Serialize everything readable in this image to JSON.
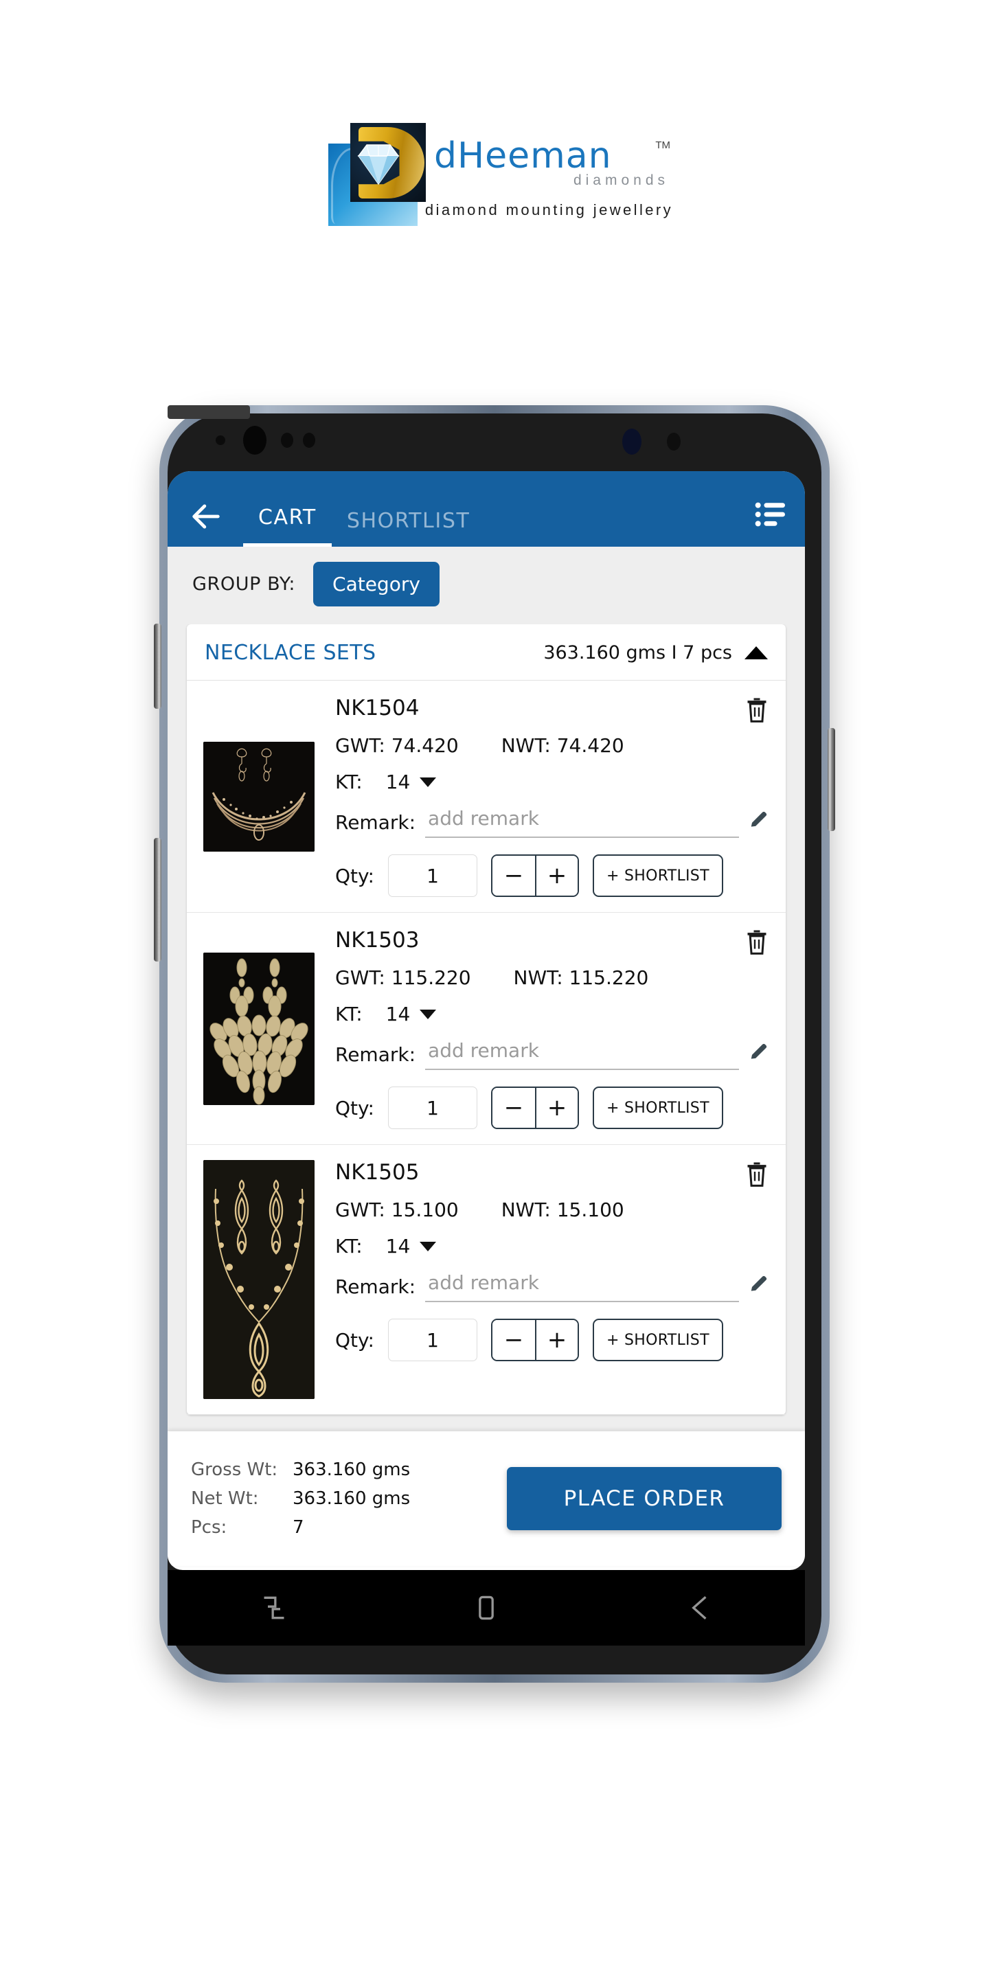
{
  "brand": {
    "name": "dHeeman",
    "tm": "TM",
    "sub": "diamonds",
    "tagline": "diamond mounting jewellery"
  },
  "appbar": {
    "back_icon": "arrow-left-icon",
    "list_icon": "list-view-icon",
    "tabs": [
      {
        "label": "CART",
        "active": true
      },
      {
        "label": "SHORTLIST",
        "active": false
      }
    ]
  },
  "groupbar": {
    "label": "GROUP BY:",
    "chip": "Category"
  },
  "group": {
    "title": "NECKLACE SETS",
    "meta": "363.160 gms I 7 pcs",
    "collapse_icon": "caret-up-icon"
  },
  "labels": {
    "gwt": "GWT:",
    "nwt": "NWT:",
    "kt": "KT:",
    "remark": "Remark:",
    "qty": "Qty:",
    "minus": "−",
    "plus": "+",
    "shortlist": "+ SHORTLIST",
    "remark_placeholder": "add remark",
    "trash_icon": "trash-icon",
    "pencil_icon": "pencil-edit-icon",
    "kt_caret_icon": "caret-down-icon"
  },
  "items": [
    {
      "sku": "NK1504",
      "gwt": "74.420",
      "nwt": "74.420",
      "kt": "14",
      "qty": "1",
      "thumb": "necklace-earrings-mesh-choker"
    },
    {
      "sku": "NK1503",
      "gwt": "115.220",
      "nwt": "115.220",
      "kt": "14",
      "qty": "1",
      "thumb": "necklace-earrings-bib-collar"
    },
    {
      "sku": "NK1505",
      "gwt": "15.100",
      "nwt": "15.100",
      "kt": "14",
      "qty": "1",
      "thumb": "necklace-earrings-pendant-chain"
    }
  ],
  "footer": {
    "rows": [
      {
        "label": "Gross Wt:",
        "value": "363.160 gms"
      },
      {
        "label": "Net Wt:",
        "value": "363.160 gms"
      },
      {
        "label": "Pcs:",
        "value": "7"
      }
    ],
    "place_order": "PLACE ORDER"
  },
  "navbar": {
    "recents_icon": "recents-icon",
    "home_icon": "home-square-icon",
    "back_icon": "nav-back-arrow-icon"
  },
  "colors": {
    "primary_blue": "#15609f",
    "group_title_blue": "#1565a8",
    "page_bg": "#eeeeee"
  }
}
